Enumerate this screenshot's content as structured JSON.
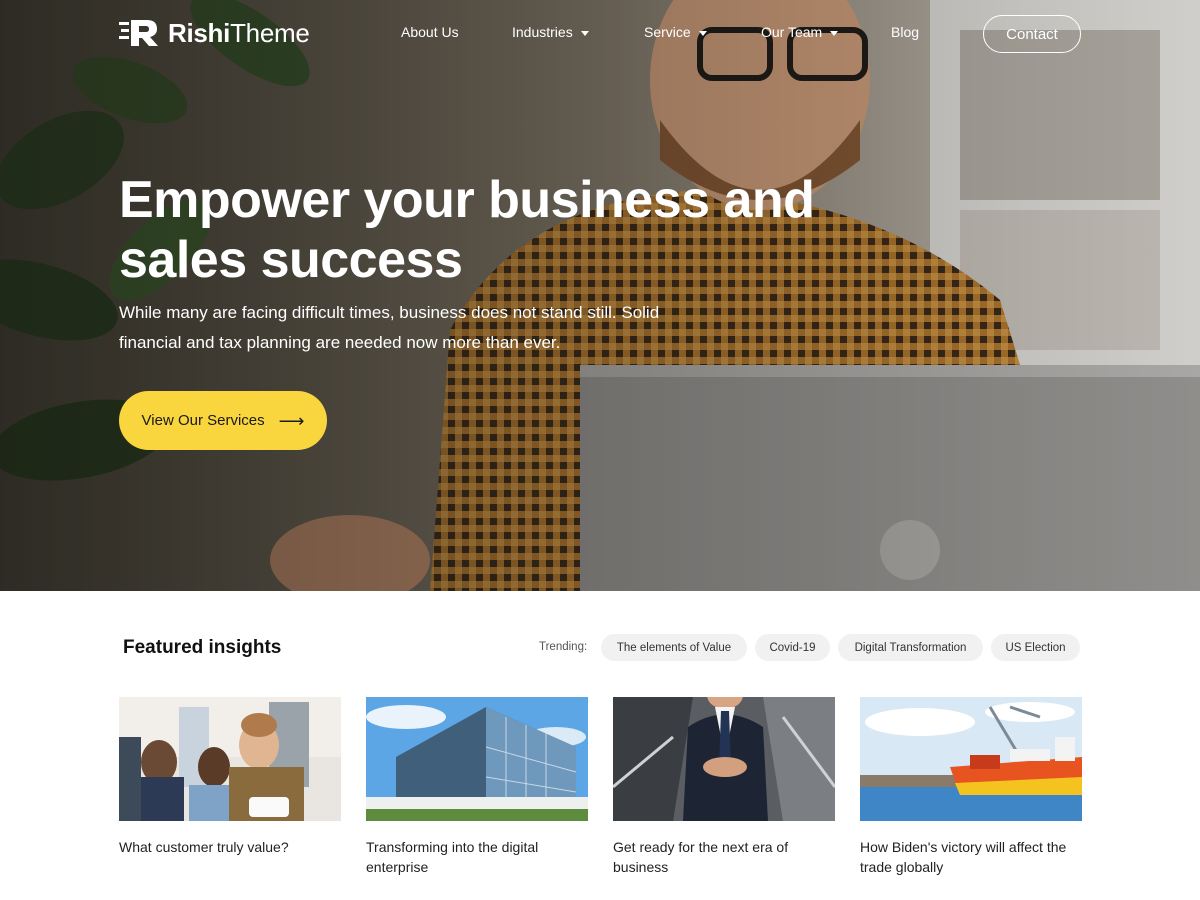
{
  "brand": {
    "name_bold": "Rishi",
    "name_regular": "Theme",
    "logo_icon": "rishi-logo-icon"
  },
  "nav": {
    "items": [
      {
        "label": "About Us",
        "has_dropdown": false
      },
      {
        "label": "Industries",
        "has_dropdown": true
      },
      {
        "label": "Service",
        "has_dropdown": true
      },
      {
        "label": "Our Team",
        "has_dropdown": true
      },
      {
        "label": "Blog",
        "has_dropdown": false
      }
    ],
    "contact_label": "Contact"
  },
  "hero": {
    "title": "Empower your business and sales success",
    "subtitle": "While many are facing difficult times, business does not stand still. Solid financial and tax planning are needed now more than ever.",
    "cta_label": "View Our Services",
    "cta_icon": "arrow-right-icon"
  },
  "insights": {
    "title": "Featured insights",
    "trending_label": "Trending:",
    "trending_tags": [
      "The elements of Value",
      "Covid-19",
      "Digital Transformation",
      "US Election"
    ],
    "cards": [
      {
        "title": "What customer truly value?",
        "image": "team-meeting-photo"
      },
      {
        "title": "Transforming into the digital enterprise",
        "image": "glass-office-building-photo"
      },
      {
        "title": "Get ready for the next era of business",
        "image": "businessman-suit-photo"
      },
      {
        "title": "How Biden's victory will affect the trade globally",
        "image": "cargo-ship-port-photo"
      }
    ]
  },
  "colors": {
    "accent": "#f9d63d",
    "text_dark": "#1a1a1a",
    "chip_bg": "#f1f1f1"
  }
}
